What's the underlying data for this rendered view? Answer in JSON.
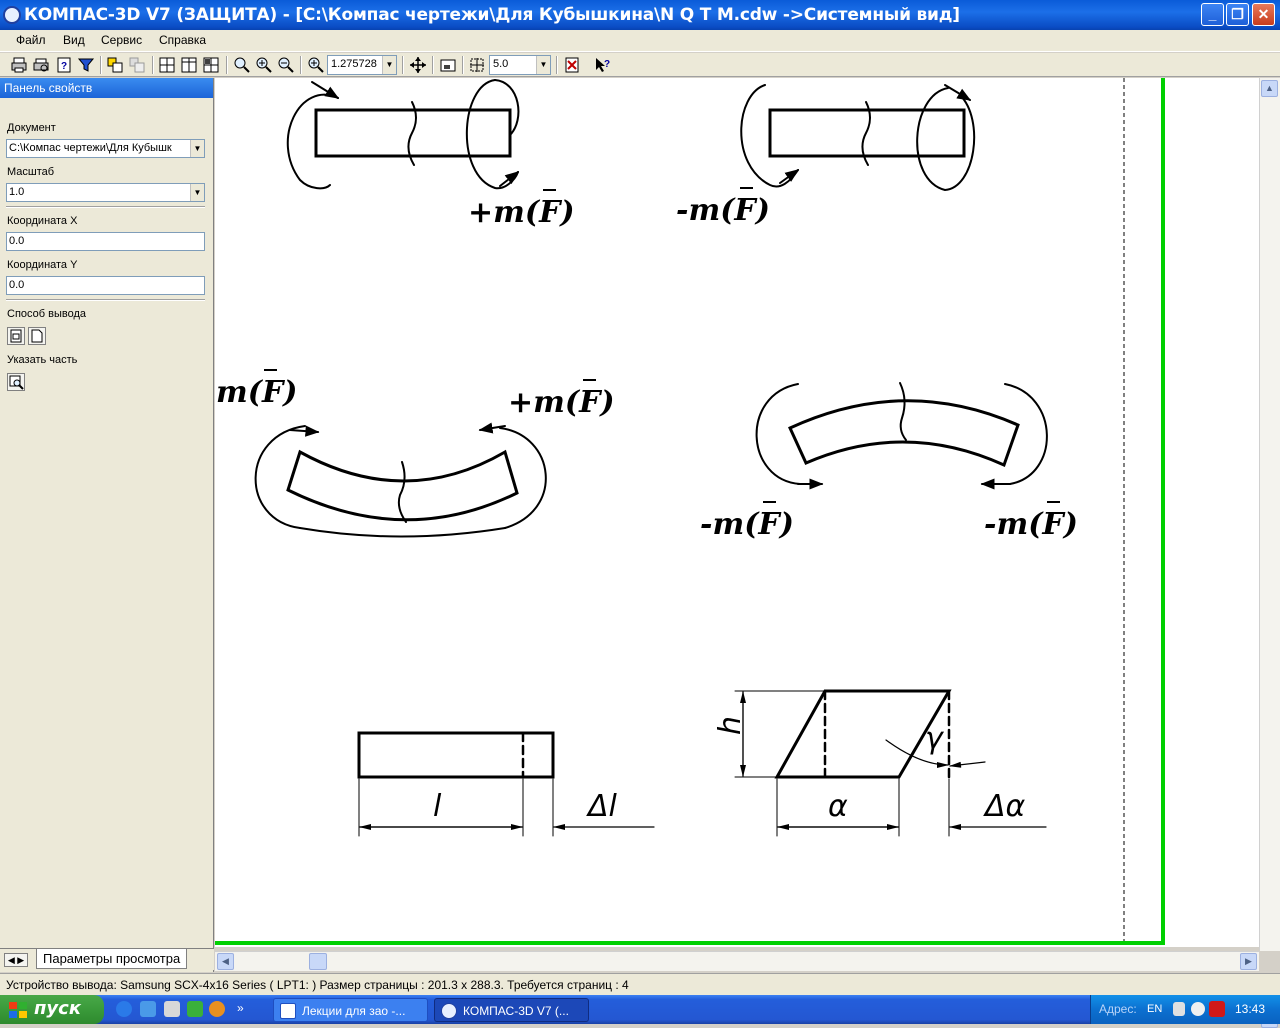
{
  "window": {
    "title": "КОМПАС-3D V7 (ЗАЩИТА) - [C:\\Компас чертежи\\Для Кубышкина\\N Q T M.cdw ->Системный вид]",
    "minimize": "_",
    "restore": "❐",
    "close": "✕"
  },
  "menu": {
    "file": "Файл",
    "view": "Вид",
    "service": "Сервис",
    "help": "Справка"
  },
  "toolbar": {
    "zoom_value": "1.275728",
    "step_value": "5.0"
  },
  "panel": {
    "header": "Панель свойств",
    "document_label": "Документ",
    "document_value": "C:\\Компас чертежи\\Для Кубышк",
    "scale_label": "Масштаб",
    "scale_value": "1.0",
    "coord_x_label": "Координата X",
    "coord_x_value": "0.0",
    "coord_y_label": "Координата Y",
    "coord_y_value": "0.0",
    "output_label": "Способ вывода",
    "part_label": "Указать часть",
    "tab_label": "Параметры просмотра"
  },
  "drawing": {
    "label_plus_top": "+m(F)",
    "label_minus_top": "-m(F)",
    "label_minus_left": "m(F)",
    "label_plus_mid": "+m(F)",
    "label_minus_bl": "-m(F)",
    "label_minus_br": "-m(F)",
    "dim_l": "l",
    "dim_dl": "Δl",
    "dim_h": "h",
    "dim_gamma": "γ",
    "dim_alpha": "α",
    "dim_dalpha": "Δα"
  },
  "status": {
    "text": "Устройство вывода: Samsung SCX-4x16 Series ( LPT1: )  Размер страницы : 201.3 x 288.3.  Требуется страниц : 4"
  },
  "taskbar": {
    "start": "пуск",
    "task1": "Лекции для зао -...",
    "task2": "КОМПАС-3D V7 (...",
    "address": "Адрес:",
    "lang": "EN",
    "clock": "13:43"
  }
}
